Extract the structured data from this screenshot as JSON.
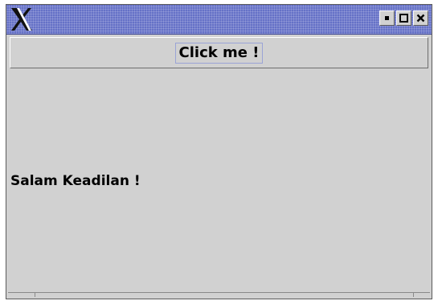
{
  "window": {
    "icon": "x-logo-icon",
    "controls": {
      "minimize_icon": "minimize-icon",
      "maximize_icon": "maximize-icon",
      "close_icon": "close-icon"
    }
  },
  "toolbar": {
    "button_label": "Click me !"
  },
  "main": {
    "message": "Salam Keadilan !"
  },
  "colors": {
    "titlebar": "#6571c7",
    "background": "#d1d1d1",
    "button_focus_border": "#9aa3d6"
  }
}
